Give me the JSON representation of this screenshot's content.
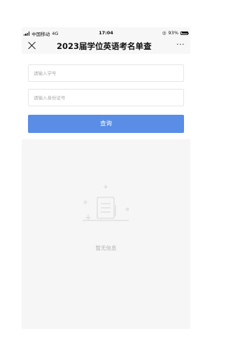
{
  "status_bar": {
    "carrier": "中国移动",
    "network": "4G",
    "time": "17:04",
    "battery_percent": "93%"
  },
  "nav": {
    "title": "2023届学位英语考名单查",
    "more_label": "···"
  },
  "form": {
    "student_id_placeholder": "请输入学号",
    "id_card_placeholder": "请输入身份证号",
    "query_label": "查询"
  },
  "result": {
    "empty_text": "暂无信息"
  },
  "colors": {
    "accent": "#5a8de6",
    "bar_bg": "#f7f7f7",
    "result_bg": "#f6f6f6"
  },
  "icons": [
    "signal-icon",
    "close-icon",
    "more-icon",
    "empty-document-icon"
  ]
}
